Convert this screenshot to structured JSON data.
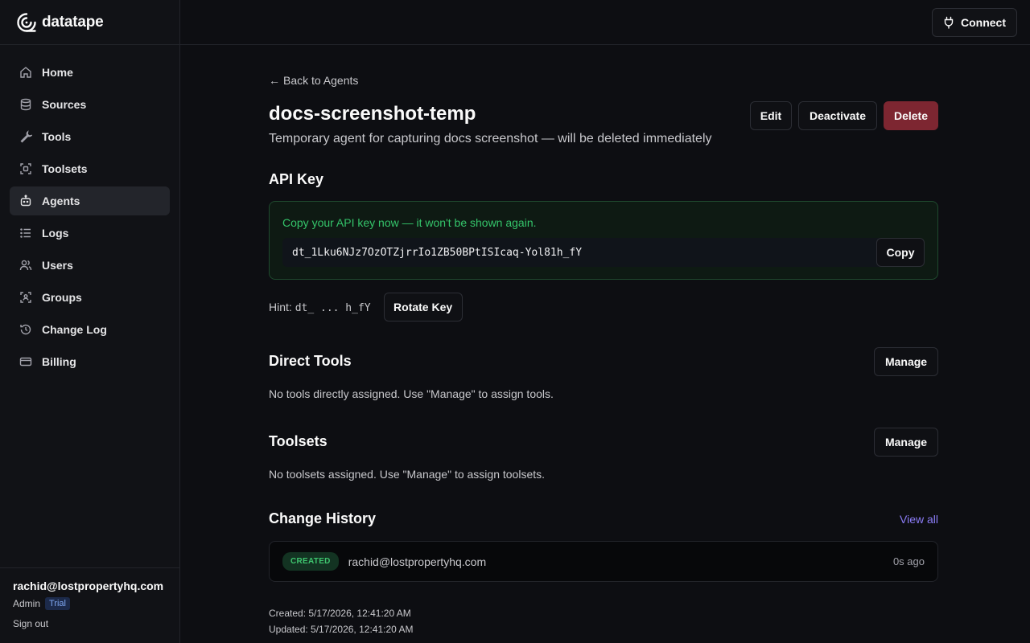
{
  "brand": {
    "name": "datatape"
  },
  "topbar": {
    "connect_label": "Connect"
  },
  "sidebar": {
    "items": [
      {
        "label": "Home",
        "icon": "home-icon"
      },
      {
        "label": "Sources",
        "icon": "database-icon"
      },
      {
        "label": "Tools",
        "icon": "wrench-icon"
      },
      {
        "label": "Toolsets",
        "icon": "scan-icon"
      },
      {
        "label": "Agents",
        "icon": "bot-icon",
        "active": true
      },
      {
        "label": "Logs",
        "icon": "list-icon"
      },
      {
        "label": "Users",
        "icon": "users-icon"
      },
      {
        "label": "Groups",
        "icon": "group-icon"
      },
      {
        "label": "Change Log",
        "icon": "history-icon"
      },
      {
        "label": "Billing",
        "icon": "credit-card-icon"
      }
    ],
    "footer": {
      "email": "rachid@lostpropertyhq.com",
      "role": "Admin",
      "plan_badge": "Trial",
      "sign_out": "Sign out"
    }
  },
  "page": {
    "back_link": "Back to Agents",
    "title": "docs-screenshot-temp",
    "description": "Temporary agent for capturing docs screenshot — will be deleted immediately",
    "actions": {
      "edit": "Edit",
      "deactivate": "Deactivate",
      "delete": "Delete"
    }
  },
  "api_key": {
    "section_title": "API Key",
    "warning": "Copy your API key now — it won't be shown again.",
    "value": "dt_1Lku6NJz7OzOTZjrrIo1ZB50BPtISIcaq-Yol81h_fY",
    "copy_label": "Copy",
    "hint_label": "Hint:",
    "hint_value": "dt_ ... h_fY",
    "rotate_label": "Rotate Key"
  },
  "direct_tools": {
    "section_title": "Direct Tools",
    "manage_label": "Manage",
    "empty_text": "No tools directly assigned. Use \"Manage\" to assign tools."
  },
  "toolsets": {
    "section_title": "Toolsets",
    "manage_label": "Manage",
    "empty_text": "No toolsets assigned. Use \"Manage\" to assign toolsets."
  },
  "change_history": {
    "section_title": "Change History",
    "view_all": "View all",
    "entries": [
      {
        "badge": "CREATED",
        "user": "rachid@lostpropertyhq.com",
        "time": "0s ago"
      }
    ]
  },
  "meta": {
    "created": "Created: 5/17/2026, 12:41:20 AM",
    "updated": "Updated: 5/17/2026, 12:41:20 AM"
  },
  "colors": {
    "accent_link": "#8b7cf6",
    "danger": "#7d2631",
    "success": "#34c46a"
  }
}
